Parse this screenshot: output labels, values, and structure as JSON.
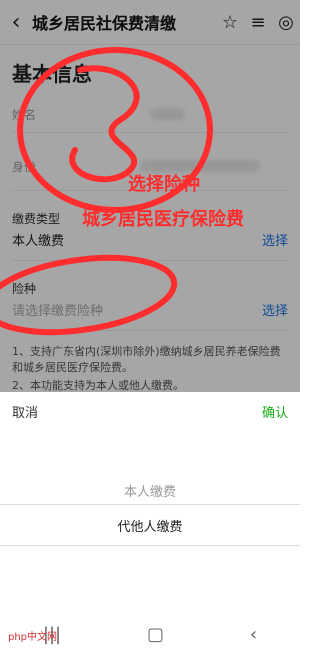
{
  "header": {
    "title": "城乡居民社保费清缴",
    "back_icon": "back-arrow-icon",
    "tools": [
      "star-icon",
      "menu-icon",
      "target-icon"
    ]
  },
  "form": {
    "section_title": "基本信息",
    "name_label": "姓名",
    "id_label": "身份",
    "pay_type_label": "缴费类型",
    "pay_type_value": "本人缴费",
    "pay_type_action": "选择",
    "insurance_label": "险种",
    "insurance_placeholder": "请选择缴费险种",
    "insurance_action": "选择",
    "notice_1": "1、支持广东省内(深圳市除外)缴纳城乡居民养老保险费和城乡居民医疗保险费。",
    "notice_2": "2、本功能支持为本人或他人缴费。"
  },
  "picker": {
    "cancel": "取消",
    "confirm": "确认",
    "options": [
      "本人缴费",
      "代他人缴费"
    ],
    "selected_index": 1
  },
  "annotations": {
    "step_number": "3",
    "choose_text": "选择险种",
    "product_text": "城乡居民医疗保险费",
    "color": "#ff2d2d"
  },
  "watermark": "php中文网",
  "system_nav": [
    "recent-icon",
    "home-icon",
    "back-icon"
  ]
}
